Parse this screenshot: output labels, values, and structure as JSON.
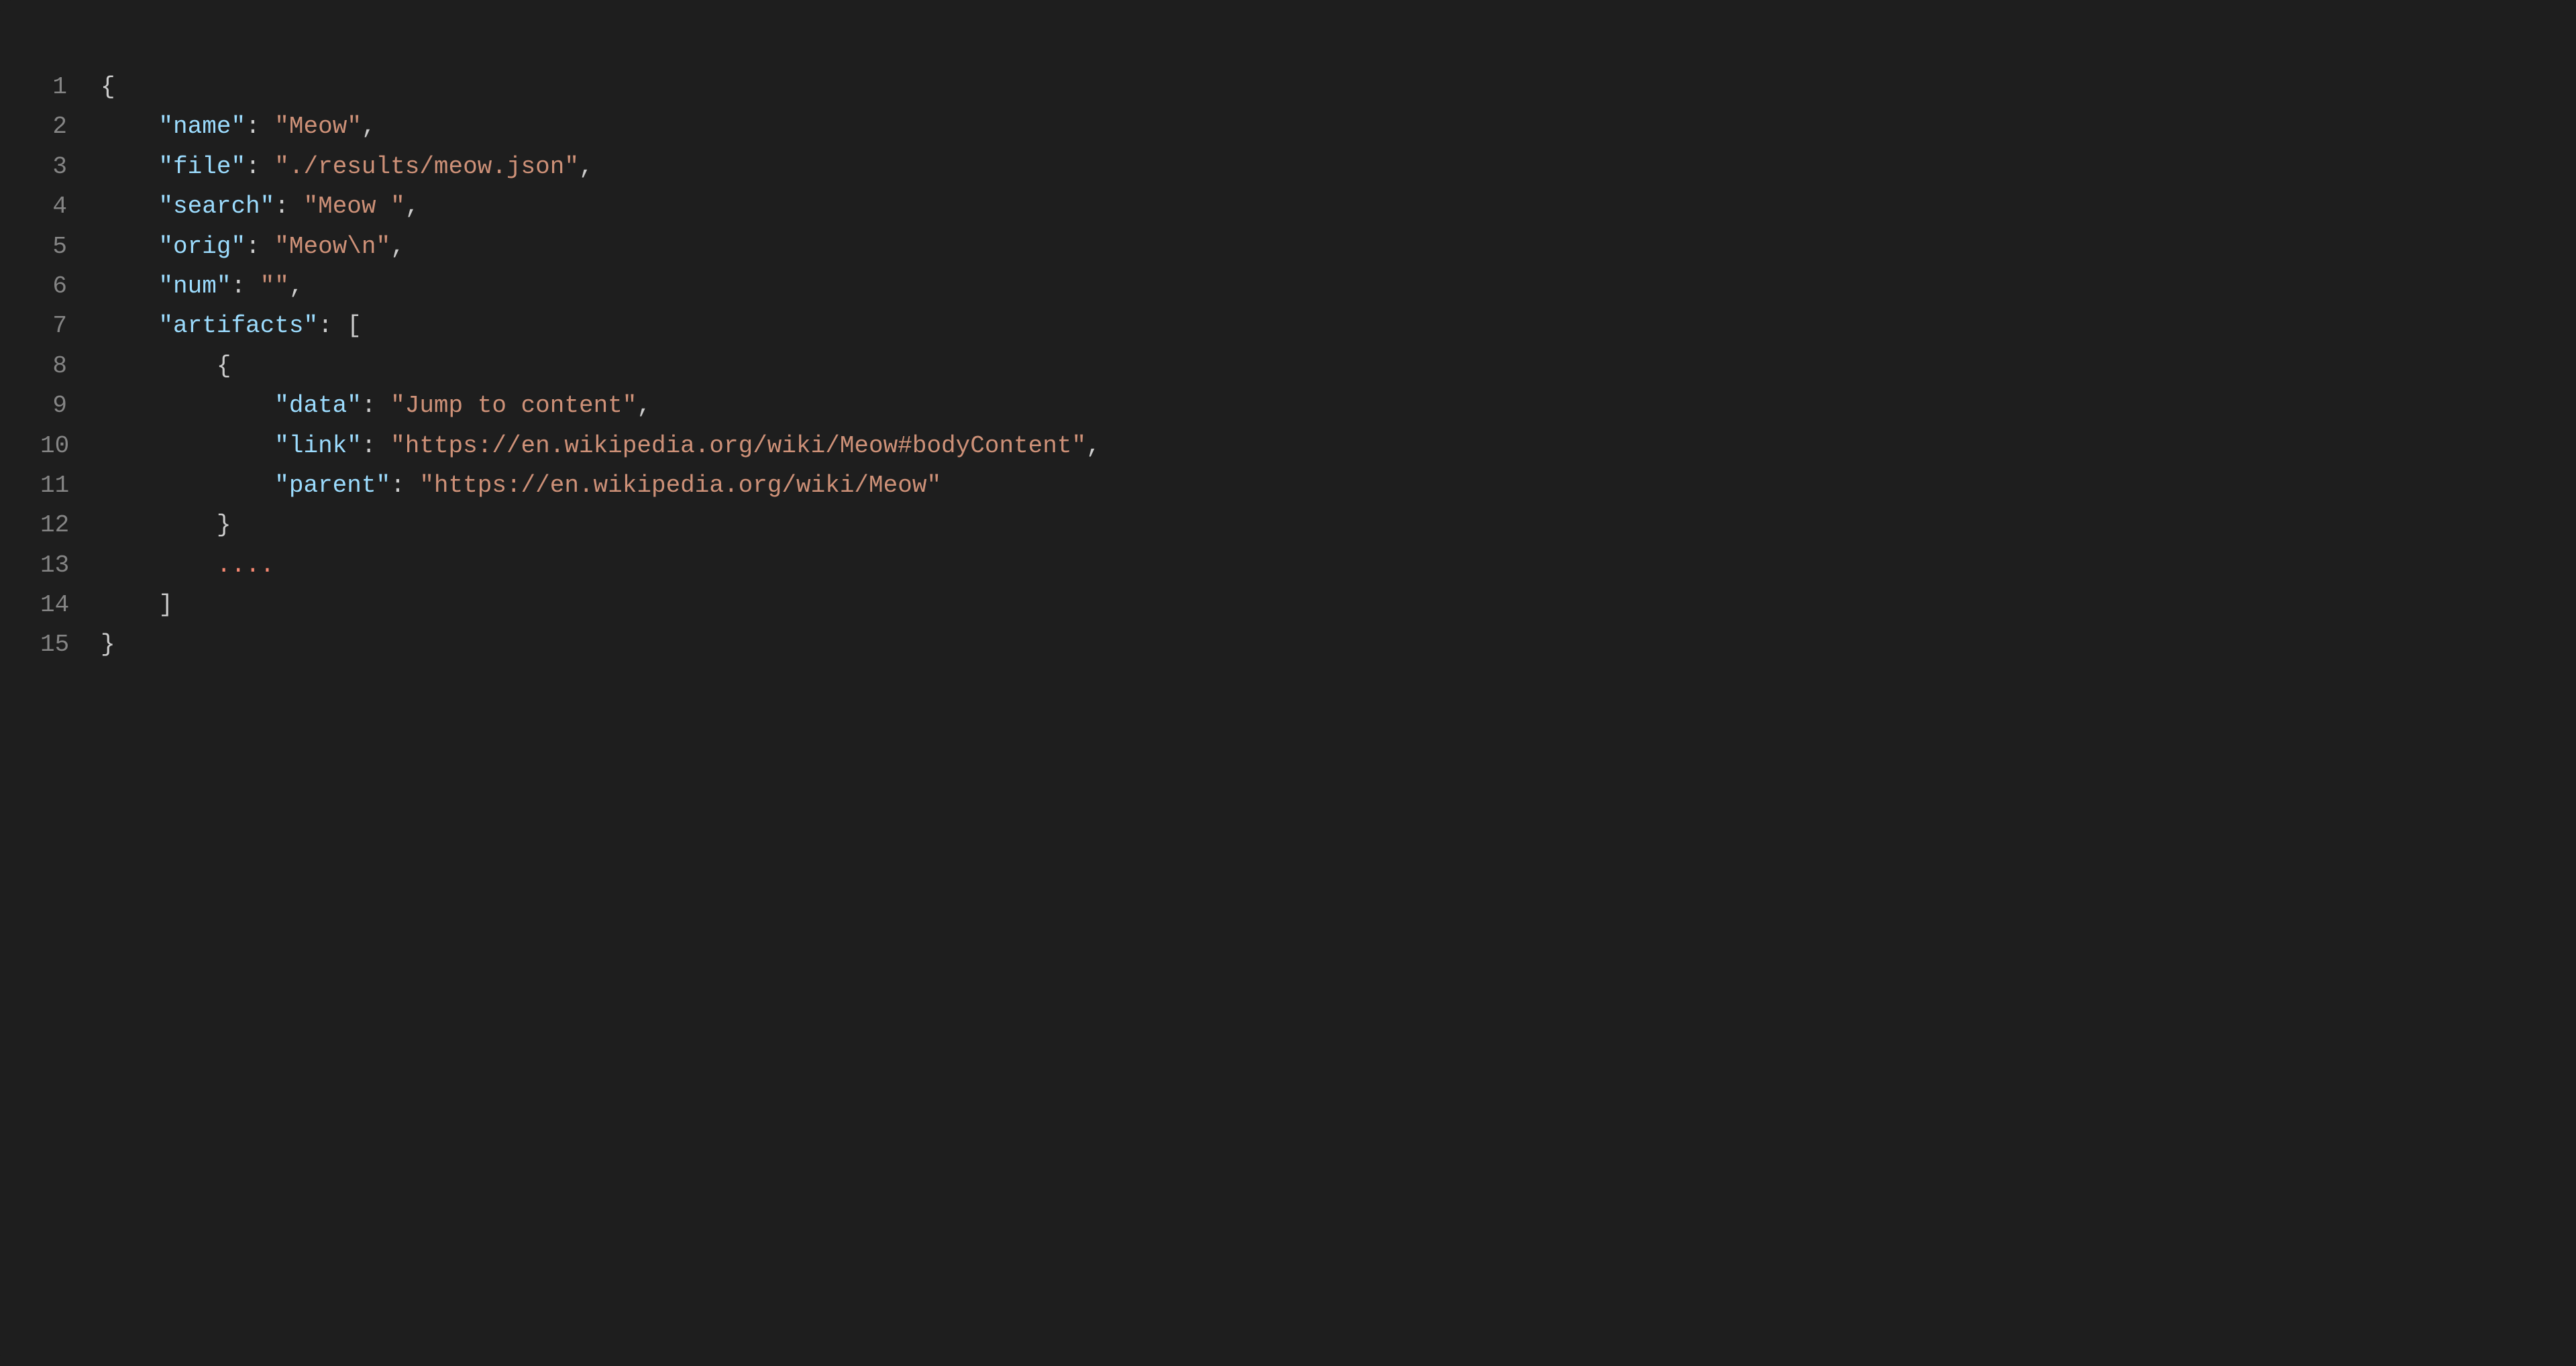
{
  "lineNumbers": [
    "1",
    "2",
    "3",
    "4",
    "5",
    "6",
    "7",
    "8",
    "9",
    "10",
    "11",
    "12",
    "13",
    "14",
    "15"
  ],
  "tokens": {
    "brace_open": "{",
    "brace_close": "}",
    "bracket_open": "[",
    "bracket_close": "]",
    "comma": ",",
    "colon": ":",
    "quote": "\"",
    "key_name": "name",
    "val_name": "Meow",
    "key_file": "file",
    "val_file": "./results/meow.json",
    "key_search": "search",
    "val_search": "Meow ",
    "key_orig": "orig",
    "val_orig": "Meow\\n",
    "key_num": "num",
    "val_num": "",
    "key_artifacts": "artifacts",
    "key_data": "data",
    "val_data": "Jump to content",
    "key_link": "link",
    "val_link": "https://en.wikipedia.org/wiki/Meow#bodyContent",
    "key_parent": "parent",
    "val_parent": "https://en.wikipedia.org/wiki/Meow",
    "ellipsis": "...."
  },
  "indent": {
    "i0": "",
    "i1": "    ",
    "i2": "        ",
    "i3": "            "
  }
}
